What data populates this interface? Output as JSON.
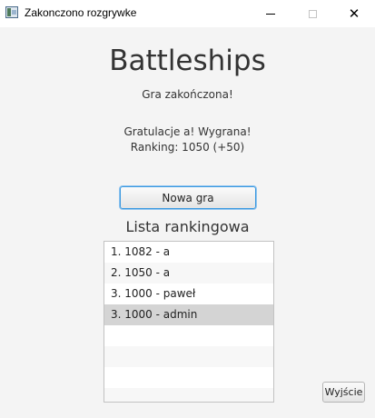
{
  "window": {
    "title": "Zakonczono rozgrywke"
  },
  "game": {
    "title": "Battleships",
    "status": "Gra zakończona!",
    "result_line1": "Gratulacje a! Wygrana!",
    "result_line2": "Ranking: 1050 (+50)"
  },
  "buttons": {
    "new_game": "Nowa gra",
    "exit": "Wyjście"
  },
  "ranking": {
    "title": "Lista rankingowa",
    "selected_index": 3,
    "items": [
      "1. 1082 - a",
      "2. 1050 - a",
      "3. 1000 - paweł",
      "3. 1000 - admin"
    ]
  },
  "icons": {
    "app": "app-window-icon",
    "minimize": "minimize-icon",
    "maximize": "maximize-icon",
    "close": "close-icon"
  }
}
